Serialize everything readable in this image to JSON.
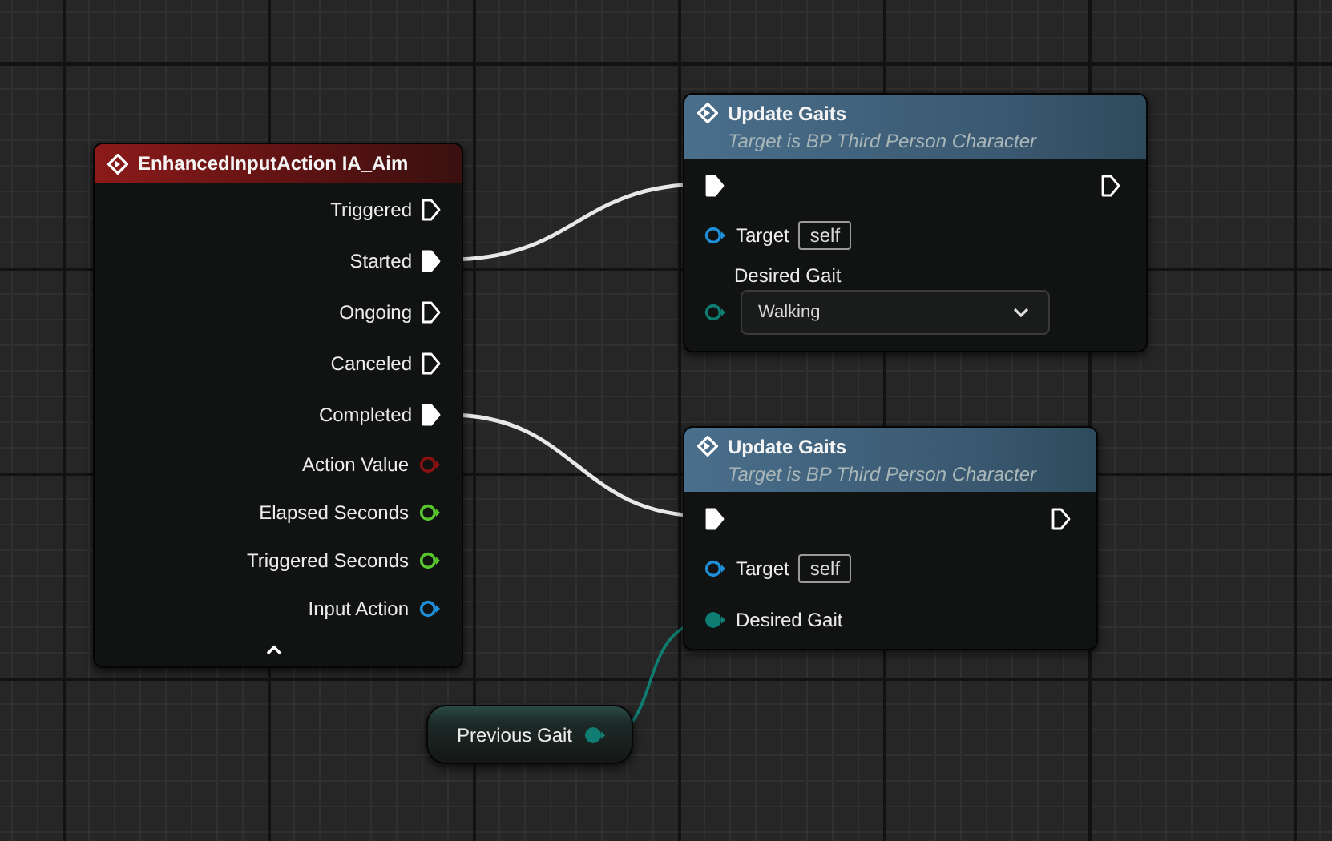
{
  "graph": {
    "nodes": [
      {
        "kind": "event",
        "title": "EnhancedInputAction IA_Aim",
        "color": "#8c1a1a",
        "pins": [
          {
            "label": "Triggered",
            "kind": "exec",
            "connected": false
          },
          {
            "label": "Started",
            "kind": "exec",
            "connected": true
          },
          {
            "label": "Ongoing",
            "kind": "exec",
            "connected": false
          },
          {
            "label": "Canceled",
            "kind": "exec",
            "connected": false
          },
          {
            "label": "Completed",
            "kind": "exec",
            "connected": true
          },
          {
            "label": "Action Value",
            "kind": "data",
            "color": "#8a1212",
            "connected": false
          },
          {
            "label": "Elapsed Seconds",
            "kind": "data",
            "color": "#57c72e",
            "connected": false
          },
          {
            "label": "Triggered Seconds",
            "kind": "data",
            "color": "#57c72e",
            "connected": false
          },
          {
            "label": "Input Action",
            "kind": "data",
            "color": "#1e8fd8",
            "connected": false
          }
        ]
      },
      {
        "kind": "function",
        "title": "Update Gaits",
        "subtitle": "Target is BP Third Person Character",
        "exec_in": {
          "connected": true
        },
        "exec_out": {
          "connected": false
        },
        "inputs": [
          {
            "label": "Target",
            "kind": "text",
            "value": "self",
            "color": "#1e8fd8",
            "connected": false
          },
          {
            "label": "Desired Gait",
            "kind": "dropdown",
            "value": "Walking",
            "color": "#0f7d72",
            "connected": false
          }
        ]
      },
      {
        "kind": "function",
        "title": "Update Gaits",
        "subtitle": "Target is BP Third Person Character",
        "exec_in": {
          "connected": true
        },
        "exec_out": {
          "connected": false
        },
        "inputs": [
          {
            "label": "Target",
            "kind": "text",
            "value": "self",
            "color": "#1e8fd8",
            "connected": false
          },
          {
            "label": "Desired Gait",
            "kind": "none",
            "color": "#0f7d72",
            "connected": true
          }
        ]
      },
      {
        "kind": "variable",
        "label": "Previous Gait",
        "color": "#0f7d72",
        "connected": true
      }
    ]
  }
}
